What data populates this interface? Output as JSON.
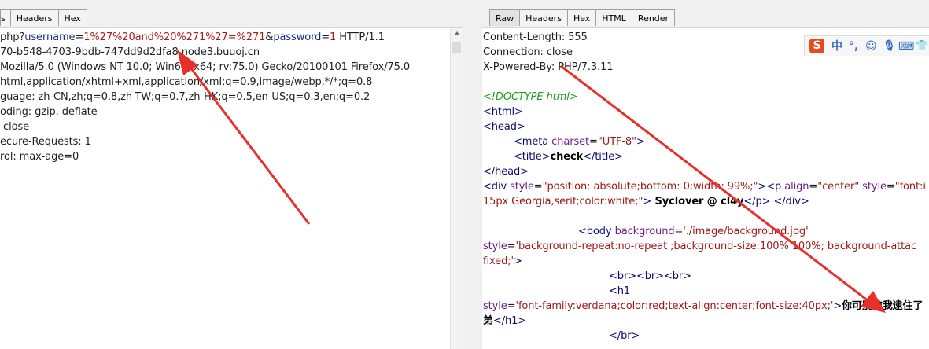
{
  "request_tabs": [
    "s",
    "Headers",
    "Hex"
  ],
  "response_tabs": [
    "Raw",
    "Headers",
    "Hex",
    "HTML",
    "Render"
  ],
  "request": {
    "l1": {
      "a": "php?",
      "b": "username",
      "c": "=",
      "d": "1%27%20and%20%271%27=%271",
      "e": "&",
      "f": "password",
      "g": "=",
      "h": "1",
      "i": " HTTP/1.1"
    },
    "l2": "70-b548-4703-9bdb-747dd9d2dfa8.node3.buuoj.cn",
    "l3": "Mozilla/5.0 (Windows NT 10.0; Win64; x64; rv:75.0) Gecko/20100101 Firefox/75.0",
    "l4": "html,application/xhtml+xml,application/xml;q=0.9,image/webp,*/*;q=0.8",
    "l5": "guage: zh-CN,zh;q=0.8,zh-TW;q=0.7,zh-HK;q=0.5,en-US;q=0.3,en;q=0.2",
    "l6": "oding: gzip, deflate",
    "l7": " close",
    "l8": "ecure-Requests: 1",
    "l9": "rol: max-age=0"
  },
  "response": {
    "h1": "Content-Length: 555",
    "h2": "Connection: close",
    "h3": "X-Powered-By: PHP/7.3.11",
    "doctype": "<!DOCTYPE html>",
    "html_open": "<html>",
    "head_open": "<head>",
    "meta": {
      "lt": "<",
      "tag": "meta",
      "attr": " charset",
      "eq": "=",
      "val": "\"UTF-8\"",
      "gt": ">"
    },
    "title": {
      "open": "<title>",
      "text": "check",
      "close": "</title>"
    },
    "head_close": "</head>",
    "div": {
      "lt": "<",
      "tag": "div",
      "attr1": " style",
      "eq1": "=",
      "val1": "\"position: absolute;bottom: 0;width: 99%;\"",
      "gt1": ">",
      "lt2": "<",
      "tag2": "p",
      "attr2": " align",
      "eq2": "=",
      "val2": "\"center\"",
      "attr3": " style",
      "eq3": "=",
      "val3": "\"font:i"
    },
    "div_cont": {
      "val": "15px Georgia,serif;color:white;\"",
      "gt": ">",
      "text": " Syclover @ cl4y",
      "close": "</p>",
      "sp": " ",
      "close2": "</div>"
    },
    "body": {
      "lt": "<",
      "tag": "body",
      "attr": " background",
      "eq": "=",
      "val": "'./image/background.jpg'"
    },
    "body_cont1": {
      "attr": "style",
      "eq": "=",
      "val": "'background-repeat:no-repeat ;background-size:100% 100%; background-attac"
    },
    "body_cont2": {
      "val": "fixed;'",
      "gt": ">"
    },
    "br": {
      "a": "<br>",
      "b": "<br>",
      "c": "<br>"
    },
    "h1_open": "<h1",
    "h1_cont": {
      "attr": "style",
      "eq": "=",
      "val": "'font-family:verdana;color:red;text-align:center;font-size:40px;'",
      "gt": ">",
      "text": "你可别被我逮住了"
    },
    "h1_end": {
      "text": "弟",
      "close": "</h1>"
    },
    "br_close": "</br>"
  },
  "ime": {
    "logo": "S",
    "lang": "中",
    "punct": "°,",
    "emoji": "☺",
    "mic": "🎙",
    "keyboard": "⌨",
    "user": "👕"
  },
  "colors": {
    "arrow": "#e8302a",
    "tab_active": "#e2e2e2",
    "tag": "#0a0a78",
    "attr": "#6e1e8e",
    "value": "#a01818",
    "comment": "#1d9a1d"
  }
}
